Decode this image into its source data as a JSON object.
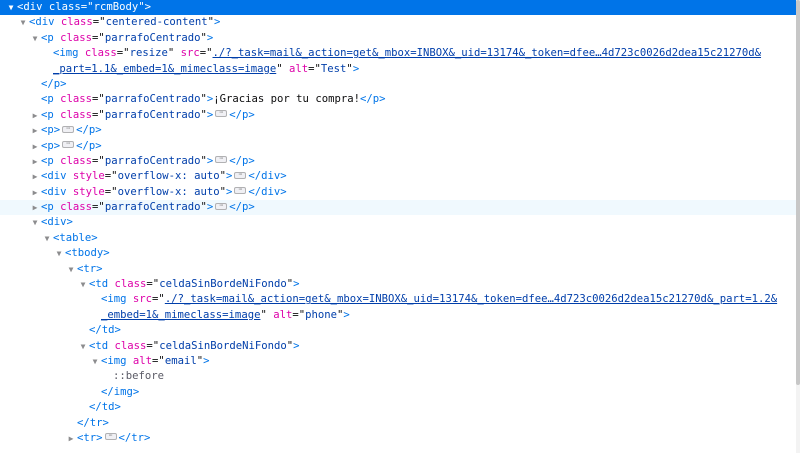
{
  "lines": [
    {
      "depth": 0,
      "tw": "open",
      "sel": true,
      "parts": [
        [
          "tag",
          "<div"
        ],
        [
          "pn",
          " "
        ],
        [
          "an",
          "class"
        ],
        [
          "pn",
          "=\""
        ],
        [
          "av",
          "rcmBody"
        ],
        [
          "pn",
          "\""
        ],
        [
          "tag",
          ">"
        ]
      ]
    },
    {
      "depth": 1,
      "tw": "open",
      "parts": [
        [
          "tag",
          "<div"
        ],
        [
          "pn",
          " "
        ],
        [
          "an",
          "class"
        ],
        [
          "pn",
          "=\""
        ],
        [
          "av",
          "centered-content"
        ],
        [
          "pn",
          "\""
        ],
        [
          "tag",
          ">"
        ]
      ]
    },
    {
      "depth": 2,
      "tw": "open",
      "parts": [
        [
          "tag",
          "<p"
        ],
        [
          "pn",
          " "
        ],
        [
          "an",
          "class"
        ],
        [
          "pn",
          "=\""
        ],
        [
          "av",
          "parrafoCentrado"
        ],
        [
          "pn",
          "\""
        ],
        [
          "tag",
          ">"
        ]
      ]
    },
    {
      "depth": 3,
      "parts": [
        [
          "tag",
          "<img"
        ],
        [
          "pn",
          " "
        ],
        [
          "an",
          "class"
        ],
        [
          "pn",
          "=\""
        ],
        [
          "av",
          "resize"
        ],
        [
          "pn",
          "\" "
        ],
        [
          "an",
          "src"
        ],
        [
          "pn",
          "=\""
        ],
        [
          "lk",
          "./?_task=mail&_action=get&_mbox=INBOX&_uid=13174&_token=dfee…4d723c0026d2dea15c21270d&"
        ]
      ]
    },
    {
      "depth": 3,
      "parts": [
        [
          "lk",
          "_part=1.1&_embed=1&_mimeclass=image"
        ],
        [
          "pn",
          "\" "
        ],
        [
          "an",
          "alt"
        ],
        [
          "pn",
          "=\""
        ],
        [
          "av",
          "Test"
        ],
        [
          "pn",
          "\""
        ],
        [
          "tag",
          ">"
        ]
      ]
    },
    {
      "depth": 2,
      "parts": [
        [
          "tag",
          "</p>"
        ]
      ]
    },
    {
      "depth": 2,
      "parts": [
        [
          "tag",
          "<p"
        ],
        [
          "pn",
          " "
        ],
        [
          "an",
          "class"
        ],
        [
          "pn",
          "=\""
        ],
        [
          "av",
          "parrafoCentrado"
        ],
        [
          "pn",
          "\""
        ],
        [
          "tag",
          ">"
        ],
        [
          "pn",
          "¡Gracias por tu compra!"
        ],
        [
          "tag",
          "</p>"
        ]
      ]
    },
    {
      "depth": 2,
      "tw": "closed",
      "parts": [
        [
          "tag",
          "<p"
        ],
        [
          "pn",
          " "
        ],
        [
          "an",
          "class"
        ],
        [
          "pn",
          "=\""
        ],
        [
          "av",
          "parrafoCentrado"
        ],
        [
          "pn",
          "\""
        ],
        [
          "tag",
          ">"
        ],
        [
          "ell",
          ""
        ],
        [
          "tag",
          "</p>"
        ]
      ]
    },
    {
      "depth": 2,
      "tw": "closed",
      "parts": [
        [
          "tag",
          "<p>"
        ],
        [
          "ell",
          ""
        ],
        [
          "tag",
          "</p>"
        ]
      ]
    },
    {
      "depth": 2,
      "tw": "closed",
      "parts": [
        [
          "tag",
          "<p>"
        ],
        [
          "ell",
          ""
        ],
        [
          "tag",
          "</p>"
        ]
      ]
    },
    {
      "depth": 2,
      "tw": "closed",
      "parts": [
        [
          "tag",
          "<p"
        ],
        [
          "pn",
          " "
        ],
        [
          "an",
          "class"
        ],
        [
          "pn",
          "=\""
        ],
        [
          "av",
          "parrafoCentrado"
        ],
        [
          "pn",
          "\""
        ],
        [
          "tag",
          ">"
        ],
        [
          "ell",
          ""
        ],
        [
          "tag",
          "</p>"
        ]
      ]
    },
    {
      "depth": 2,
      "tw": "closed",
      "parts": [
        [
          "tag",
          "<div"
        ],
        [
          "pn",
          " "
        ],
        [
          "an",
          "style"
        ],
        [
          "pn",
          "=\""
        ],
        [
          "av",
          "overflow-x: auto"
        ],
        [
          "pn",
          "\""
        ],
        [
          "tag",
          ">"
        ],
        [
          "ell",
          ""
        ],
        [
          "tag",
          "</div>"
        ]
      ]
    },
    {
      "depth": 2,
      "tw": "closed",
      "parts": [
        [
          "tag",
          "<div"
        ],
        [
          "pn",
          " "
        ],
        [
          "an",
          "style"
        ],
        [
          "pn",
          "=\""
        ],
        [
          "av",
          "overflow-x: auto"
        ],
        [
          "pn",
          "\""
        ],
        [
          "tag",
          ">"
        ],
        [
          "ell",
          ""
        ],
        [
          "tag",
          "</div>"
        ]
      ]
    },
    {
      "depth": 2,
      "tw": "closed",
      "hov": true,
      "parts": [
        [
          "tag",
          "<p"
        ],
        [
          "pn",
          " "
        ],
        [
          "an",
          "class"
        ],
        [
          "pn",
          "=\""
        ],
        [
          "av",
          "parrafoCentrado"
        ],
        [
          "pn",
          "\""
        ],
        [
          "tag",
          ">"
        ],
        [
          "ell",
          ""
        ],
        [
          "tag",
          "</p>"
        ]
      ]
    },
    {
      "depth": 2,
      "tw": "open",
      "parts": [
        [
          "tag",
          "<div>"
        ]
      ]
    },
    {
      "depth": 3,
      "tw": "open",
      "parts": [
        [
          "tag",
          "<table>"
        ]
      ]
    },
    {
      "depth": 4,
      "tw": "open",
      "parts": [
        [
          "tag",
          "<tbody>"
        ]
      ]
    },
    {
      "depth": 5,
      "tw": "open",
      "parts": [
        [
          "tag",
          "<tr>"
        ]
      ]
    },
    {
      "depth": 6,
      "tw": "open",
      "parts": [
        [
          "tag",
          "<td"
        ],
        [
          "pn",
          " "
        ],
        [
          "an",
          "class"
        ],
        [
          "pn",
          "=\""
        ],
        [
          "av",
          "celdaSinBordeNiFondo"
        ],
        [
          "pn",
          "\""
        ],
        [
          "tag",
          ">"
        ]
      ]
    },
    {
      "depth": 7,
      "parts": [
        [
          "tag",
          "<img"
        ],
        [
          "pn",
          " "
        ],
        [
          "an",
          "src"
        ],
        [
          "pn",
          "=\""
        ],
        [
          "lk",
          "./?_task=mail&_action=get&_mbox=INBOX&_uid=13174&_token=dfee…4d723c0026d2dea15c21270d&_part=1.2&"
        ]
      ]
    },
    {
      "depth": 7,
      "parts": [
        [
          "lk",
          "_embed=1&_mimeclass=image"
        ],
        [
          "pn",
          "\" "
        ],
        [
          "an",
          "alt"
        ],
        [
          "pn",
          "=\""
        ],
        [
          "av",
          "phone"
        ],
        [
          "pn",
          "\""
        ],
        [
          "tag",
          ">"
        ]
      ]
    },
    {
      "depth": 6,
      "parts": [
        [
          "tag",
          "</td>"
        ]
      ]
    },
    {
      "depth": 6,
      "tw": "open",
      "parts": [
        [
          "tag",
          "<td"
        ],
        [
          "pn",
          " "
        ],
        [
          "an",
          "class"
        ],
        [
          "pn",
          "=\""
        ],
        [
          "av",
          "celdaSinBordeNiFondo"
        ],
        [
          "pn",
          "\""
        ],
        [
          "tag",
          ">"
        ]
      ]
    },
    {
      "depth": 7,
      "tw": "open",
      "parts": [
        [
          "tag",
          "<img"
        ],
        [
          "pn",
          " "
        ],
        [
          "an",
          "alt"
        ],
        [
          "pn",
          "=\""
        ],
        [
          "av",
          "email"
        ],
        [
          "pn",
          "\""
        ],
        [
          "tag",
          ">"
        ]
      ]
    },
    {
      "depth": 8,
      "parts": [
        [
          "ps",
          "::before"
        ]
      ]
    },
    {
      "depth": 7,
      "parts": [
        [
          "tag",
          "</img>"
        ]
      ]
    },
    {
      "depth": 6,
      "parts": [
        [
          "tag",
          "</td>"
        ]
      ]
    },
    {
      "depth": 5,
      "parts": [
        [
          "tag",
          "</tr>"
        ]
      ]
    },
    {
      "depth": 5,
      "tw": "closed",
      "parts": [
        [
          "tag",
          "<tr>"
        ],
        [
          "ell",
          ""
        ],
        [
          "tag",
          "</tr>"
        ]
      ]
    }
  ],
  "icons": {
    "twisty_open": "▼",
    "twisty_closed": "▶",
    "ellipsis": "⋯"
  },
  "colors": {
    "tag": "#0074e8",
    "attr_name": "#dd00a9",
    "attr_value": "#003eaa",
    "selected_bg": "#0074e8",
    "hover_bg": "#f0f9fe"
  }
}
